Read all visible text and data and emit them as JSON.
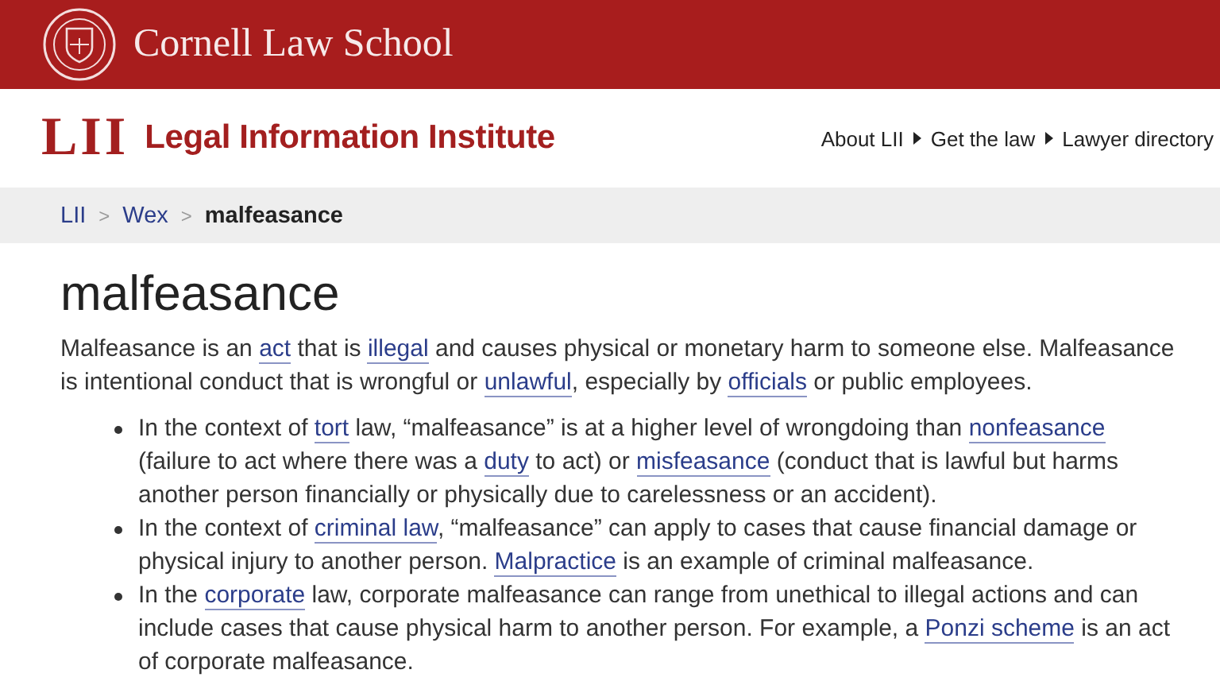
{
  "banner": {
    "title": "Cornell Law School"
  },
  "header": {
    "logo": "LII",
    "name": "Legal Information Institute",
    "nav": [
      {
        "label": "About LII"
      },
      {
        "label": "Get the law"
      },
      {
        "label": "Lawyer directory"
      }
    ]
  },
  "breadcrumb": [
    {
      "label": "LII",
      "kind": "link"
    },
    {
      "label": ">",
      "kind": "separator"
    },
    {
      "label": "Wex",
      "kind": "link"
    },
    {
      "label": ">",
      "kind": "separator"
    },
    {
      "label": "malfeasance",
      "kind": "current"
    }
  ],
  "article": {
    "title": "malfeasance",
    "intro": [
      {
        "text": "Malfeasance is an "
      },
      {
        "link": "act"
      },
      {
        "text": " that is "
      },
      {
        "link": "illegal"
      },
      {
        "text": " and causes physical or monetary harm to someone else. Malfeasance is intentional conduct that is wrongful or "
      },
      {
        "link": "unlawful"
      },
      {
        "text": ", especially by "
      },
      {
        "link": "officials"
      },
      {
        "text": " or public employees."
      }
    ],
    "bullets": [
      [
        {
          "text": "In the context of "
        },
        {
          "link": "tort"
        },
        {
          "text": " law, “malfeasance” is at a higher level of wrongdoing than "
        },
        {
          "link": "nonfeasance"
        },
        {
          "text": " (failure to act where there was a "
        },
        {
          "link": "duty"
        },
        {
          "text": " to act) or "
        },
        {
          "link": "misfeasance"
        },
        {
          "text": " (conduct that is lawful but harms another person financially or physically due to carelessness or an accident)."
        }
      ],
      [
        {
          "text": "In the context of "
        },
        {
          "link": "criminal law"
        },
        {
          "text": ", “malfeasance” can apply to cases that cause financial damage or physical injury to another person. "
        },
        {
          "link": "Malpractice"
        },
        {
          "text": " is an example of criminal malfeasance."
        }
      ],
      [
        {
          "text": "In the "
        },
        {
          "link": "corporate"
        },
        {
          "text": " law, corporate malfeasance can range from unethical to illegal actions and can include cases that cause physical harm to another person. For example, a "
        },
        {
          "link": "Ponzi scheme"
        },
        {
          "text": " is an act of corporate malfeasance."
        }
      ]
    ]
  }
}
